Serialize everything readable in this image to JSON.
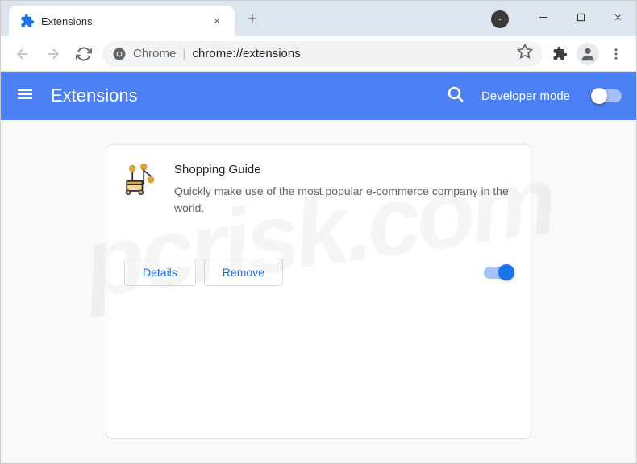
{
  "window": {
    "tab_title": "Extensions",
    "url_prefix": "Chrome",
    "url_path": "chrome://extensions"
  },
  "header": {
    "title": "Extensions",
    "developer_mode_label": "Developer mode"
  },
  "extension": {
    "name": "Shopping Guide",
    "description": "Quickly make use of the most popular e-commerce company in the world.",
    "details_button": "Details",
    "remove_button": "Remove",
    "enabled": true
  },
  "watermark": "pcrisk.com"
}
